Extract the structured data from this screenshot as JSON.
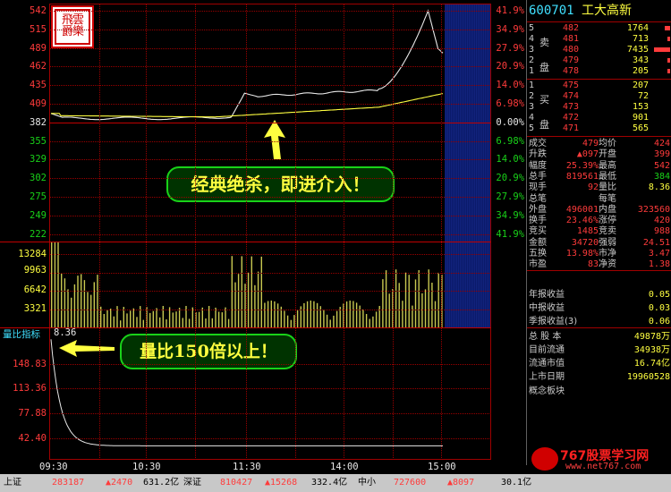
{
  "stock": {
    "code": "600701",
    "name": "工大高新"
  },
  "logo_text": "飛雲爵樂力",
  "price_axis": [
    "542",
    "515",
    "489",
    "462",
    "435",
    "409",
    "382",
    "355",
    "329",
    "302",
    "275",
    "249",
    "222"
  ],
  "pct_axis": [
    "41.9%",
    "34.9%",
    "27.9%",
    "20.9%",
    "14.0%",
    "6.98%",
    "0.00%",
    "6.98%",
    "14.0%",
    "20.9%",
    "27.9%",
    "34.9%",
    "41.9%"
  ],
  "volume_axis": [
    "13284",
    "9963",
    "6642",
    "3321"
  ],
  "vr_label": "量比指标",
  "vr_value": "8.36",
  "vr_axis": [
    "148.83",
    "113.36",
    "77.88",
    "42.40"
  ],
  "time_axis": [
    "09:30",
    "10:30",
    "11:30",
    "14:00",
    "15:00"
  ],
  "callout_top": "经典绝杀，即进介入！",
  "callout_bottom": "量比150倍以上！",
  "order_book": {
    "sell_label": [
      "卖",
      "盘"
    ],
    "buy_label": [
      "买",
      "盘"
    ],
    "sell": [
      {
        "lvl": "5",
        "price": "482",
        "vol": "1764"
      },
      {
        "lvl": "4",
        "price": "481",
        "vol": "713"
      },
      {
        "lvl": "3",
        "price": "480",
        "vol": "7435"
      },
      {
        "lvl": "2",
        "price": "479",
        "vol": "343"
      },
      {
        "lvl": "1",
        "price": "478",
        "vol": "205"
      }
    ],
    "buy": [
      {
        "lvl": "1",
        "price": "475",
        "vol": "207"
      },
      {
        "lvl": "2",
        "price": "474",
        "vol": "72"
      },
      {
        "lvl": "3",
        "price": "473",
        "vol": "153"
      },
      {
        "lvl": "4",
        "price": "472",
        "vol": "901"
      },
      {
        "lvl": "5",
        "price": "471",
        "vol": "565"
      }
    ]
  },
  "quote": [
    {
      "l1": "成交",
      "v1": "479",
      "l2": "均价",
      "v2": "424"
    },
    {
      "l1": "升跌",
      "v1": "▲097",
      "l2": "开盘",
      "v2": "399"
    },
    {
      "l1": "幅度",
      "v1": "25.39%",
      "l2": "最高",
      "v2": "542"
    },
    {
      "l1": "总手",
      "v1": "819561",
      "l2": "最低",
      "v2": "384"
    },
    {
      "l1": "现手",
      "v1": "92",
      "l2": "量比",
      "v2": "8.36"
    },
    {
      "l1": "总笔",
      "v1": "",
      "l2": "每笔",
      "v2": ""
    },
    {
      "l1": "外盘",
      "v1": "496001",
      "l2": "内盘",
      "v2": "323560"
    },
    {
      "l1": "换手",
      "v1": "23.46%",
      "l2": "涨停",
      "v2": "420"
    },
    {
      "l1": "竞买",
      "v1": "1485",
      "l2": "竞卖",
      "v2": "988"
    },
    {
      "l1": "金额",
      "v1": "34720",
      "l2": "强弱",
      "v2": "24.51"
    },
    {
      "l1": "五换",
      "v1": "13.98%",
      "l2": "市净",
      "v2": "3.47"
    },
    {
      "l1": "市盈",
      "v1": "83",
      "l2": "净资",
      "v2": "1.38"
    }
  ],
  "finance": [
    {
      "label": "年报收益",
      "value": "0.05"
    },
    {
      "label": "中报收益",
      "value": "0.03"
    },
    {
      "label": "季报收益(3)",
      "value": "0.06"
    }
  ],
  "shares": [
    {
      "label": "总 股 本",
      "value": "49878万"
    },
    {
      "label": "目前流通",
      "value": "34938万"
    },
    {
      "label": "流通市值",
      "value": "16.74亿"
    },
    {
      "label": "上市日期",
      "value": "19960528"
    }
  ],
  "concept_label": "概念板块",
  "statusbar": {
    "sh_label": "上证",
    "sh_index": "283187",
    "sh_chg": "▲2470",
    "sh_amt": "631.2亿",
    "sz_label": "深证",
    "sz_index": "810427",
    "sz_chg": "▲15268",
    "sz_amt": "332.4亿",
    "zx_label": "中小",
    "zx_index": "727600",
    "zx_chg": "▲8097",
    "zx_amt": "30.1亿"
  },
  "watermark": "767股票学习网",
  "watermark_url": "www.net767.com",
  "colors": {
    "up": "#ff3b3b",
    "down": "#19d219",
    "grid": "#9a0000",
    "price_line": "#e8e8e8",
    "avg_line": "#ffff40",
    "volume": "#c8c850"
  }
}
